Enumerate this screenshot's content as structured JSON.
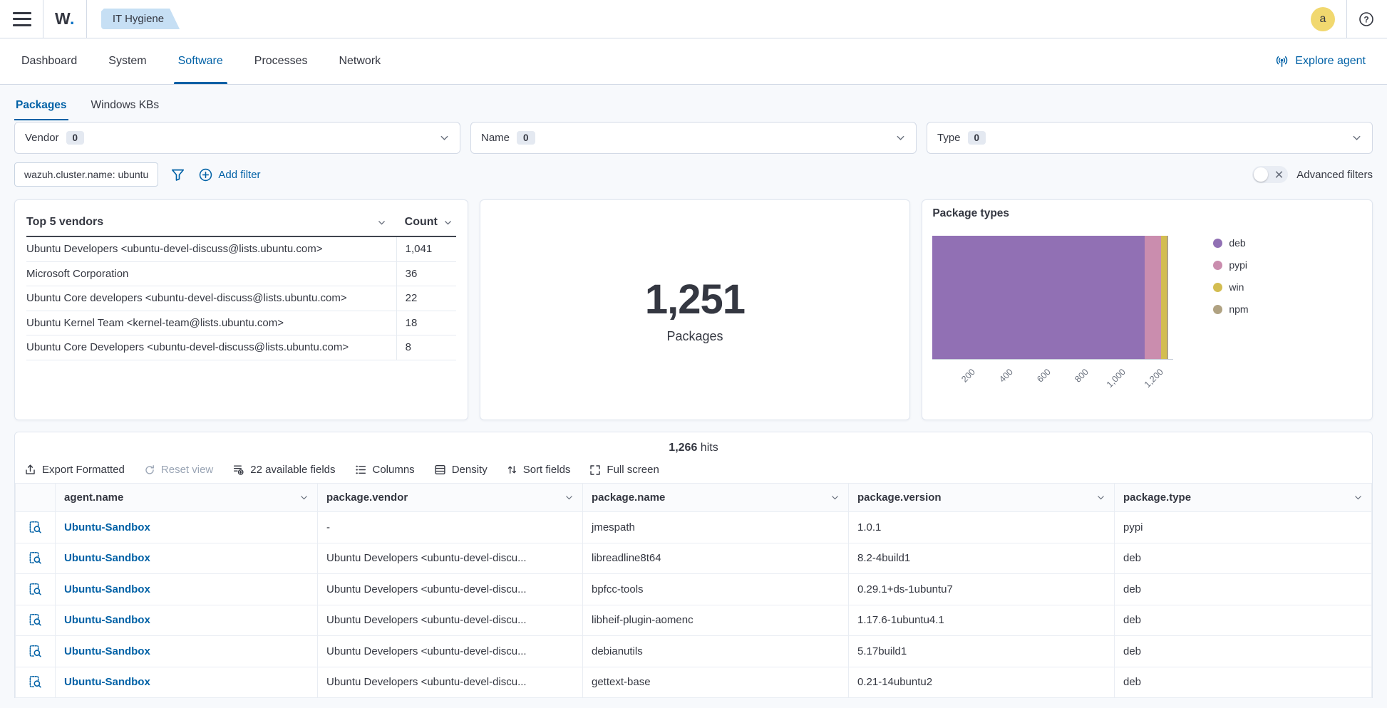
{
  "header": {
    "logo_text": "W",
    "logo_dot": ".",
    "breadcrumb": "IT Hygiene",
    "avatar_initial": "a",
    "help_glyph": "?"
  },
  "nav": {
    "tabs": [
      {
        "label": "Dashboard",
        "active": false
      },
      {
        "label": "System",
        "active": false
      },
      {
        "label": "Software",
        "active": true
      },
      {
        "label": "Processes",
        "active": false
      },
      {
        "label": "Network",
        "active": false
      }
    ],
    "explore_agent_label": "Explore agent"
  },
  "subtabs": [
    {
      "label": "Packages",
      "active": true
    },
    {
      "label": "Windows KBs",
      "active": false
    }
  ],
  "filters": {
    "selects": [
      {
        "label": "Vendor",
        "count": "0"
      },
      {
        "label": "Name",
        "count": "0"
      },
      {
        "label": "Type",
        "count": "0"
      }
    ],
    "pill": "wazuh.cluster.name: ubuntu",
    "add_filter_label": "Add filter",
    "advanced_filters_label": "Advanced filters",
    "advanced_filters_on": false
  },
  "vendors_panel": {
    "title": "Top 5 vendors",
    "count_header": "Count",
    "rows": [
      {
        "vendor": "Ubuntu Developers <ubuntu-devel-discuss@lists.ubuntu.com>",
        "count": "1,041"
      },
      {
        "vendor": "Microsoft Corporation",
        "count": "36"
      },
      {
        "vendor": "Ubuntu Core developers <ubuntu-devel-discuss@lists.ubuntu.com>",
        "count": "22"
      },
      {
        "vendor": "Ubuntu Kernel Team <kernel-team@lists.ubuntu.com>",
        "count": "18"
      },
      {
        "vendor": "Ubuntu Core Developers <ubuntu-devel-discuss@lists.ubuntu.com>",
        "count": "8"
      }
    ]
  },
  "metric_panel": {
    "value": "1,251",
    "label": "Packages"
  },
  "chart_data": {
    "type": "bar",
    "orientation": "horizontal-stacked",
    "title": "Package types",
    "series": [
      {
        "name": "deb",
        "value": 1128,
        "color": "#9170B4"
      },
      {
        "name": "pypi",
        "value": 85,
        "color": "#CA8DAE"
      },
      {
        "name": "win",
        "value": 30,
        "color": "#D3BD51"
      },
      {
        "name": "npm",
        "value": 8,
        "color": "#B0A282"
      }
    ],
    "xlim": [
      0,
      1280
    ],
    "ticks": [
      200,
      400,
      600,
      800,
      1000,
      1200
    ],
    "tick_labels": [
      "200",
      "400",
      "600",
      "800",
      "1,000",
      "1,200"
    ],
    "legend_position": "right",
    "grid": false
  },
  "results": {
    "hits_count": "1,266",
    "hits_label": "hits",
    "toolbar": [
      "Export Formatted",
      "Reset view",
      "22 available fields",
      "Columns",
      "Density",
      "Sort fields",
      "Full screen"
    ],
    "columns": [
      "agent.name",
      "package.vendor",
      "package.name",
      "package.version",
      "package.type"
    ],
    "rows": [
      [
        "Ubuntu-Sandbox",
        "-",
        "jmespath",
        "1.0.1",
        "pypi"
      ],
      [
        "Ubuntu-Sandbox",
        "Ubuntu Developers <ubuntu-devel-discu...",
        "libreadline8t64",
        "8.2-4build1",
        "deb"
      ],
      [
        "Ubuntu-Sandbox",
        "Ubuntu Developers <ubuntu-devel-discu...",
        "bpfcc-tools",
        "0.29.1+ds-1ubuntu7",
        "deb"
      ],
      [
        "Ubuntu-Sandbox",
        "Ubuntu Developers <ubuntu-devel-discu...",
        "libheif-plugin-aomenc",
        "1.17.6-1ubuntu4.1",
        "deb"
      ],
      [
        "Ubuntu-Sandbox",
        "Ubuntu Developers <ubuntu-devel-discu...",
        "debianutils",
        "5.17build1",
        "deb"
      ],
      [
        "Ubuntu-Sandbox",
        "Ubuntu Developers <ubuntu-devel-discu...",
        "gettext-base",
        "0.21-14ubuntu2",
        "deb"
      ]
    ]
  },
  "icons": {
    "hamburger": "menu",
    "help": "question-circle",
    "explore": "broadcast-antenna",
    "chevron": "chevron-down",
    "funnel": "filter-funnel",
    "add": "plus-circle",
    "toggle_off": "cross",
    "export": "export-arrow-up",
    "reset": "refresh",
    "fields": "list-plus",
    "columns": "bullet-list",
    "density": "table-density",
    "sort": "arrows-up-down",
    "fullscreen": "expand",
    "inspect": "document-magnifier"
  }
}
